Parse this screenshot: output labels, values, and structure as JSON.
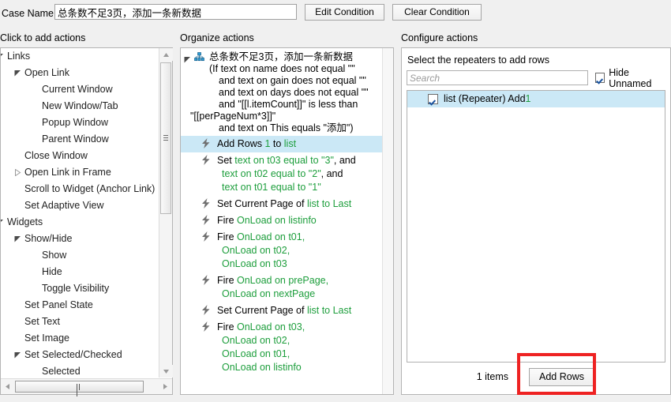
{
  "header": {
    "case_name_label": "Case Name",
    "case_name_value": "总条数不足3页，添加一条新数据",
    "edit_condition_label": "Edit Condition",
    "clear_condition_label": "Clear Condition"
  },
  "columns": {
    "left_caption": "Click to add actions",
    "mid_caption": "Organize actions",
    "right_caption": "Configure actions"
  },
  "action_tree": {
    "items": [
      {
        "label": "Links",
        "level": 0,
        "twisty": "expanded"
      },
      {
        "label": "Open Link",
        "level": 1,
        "twisty": "expanded"
      },
      {
        "label": "Current Window",
        "level": 2,
        "twisty": "none"
      },
      {
        "label": "New Window/Tab",
        "level": 2,
        "twisty": "none"
      },
      {
        "label": "Popup Window",
        "level": 2,
        "twisty": "none"
      },
      {
        "label": "Parent Window",
        "level": 2,
        "twisty": "none"
      },
      {
        "label": "Close Window",
        "level": 1,
        "twisty": "none"
      },
      {
        "label": "Open Link in Frame",
        "level": 1,
        "twisty": "collapsed"
      },
      {
        "label": "Scroll to Widget (Anchor Link)",
        "level": 1,
        "twisty": "none"
      },
      {
        "label": "Set Adaptive View",
        "level": 1,
        "twisty": "none"
      },
      {
        "label": "Widgets",
        "level": 0,
        "twisty": "expanded"
      },
      {
        "label": "Show/Hide",
        "level": 1,
        "twisty": "expanded"
      },
      {
        "label": "Show",
        "level": 2,
        "twisty": "none"
      },
      {
        "label": "Hide",
        "level": 2,
        "twisty": "none"
      },
      {
        "label": "Toggle Visibility",
        "level": 2,
        "twisty": "none"
      },
      {
        "label": "Set Panel State",
        "level": 1,
        "twisty": "none"
      },
      {
        "label": "Set Text",
        "level": 1,
        "twisty": "none"
      },
      {
        "label": "Set Image",
        "level": 1,
        "twisty": "none"
      },
      {
        "label": "Set Selected/Checked",
        "level": 1,
        "twisty": "expanded"
      },
      {
        "label": "Selected",
        "level": 2,
        "twisty": "none"
      }
    ]
  },
  "organize": {
    "case_title": "总条数不足3页，添加一条新数据",
    "condition_lines": [
      {
        "text": "(If text on name does not equal \"\"",
        "indent": 0
      },
      {
        "text": "and text on gain does not equal \"\"",
        "indent": 1
      },
      {
        "text": "and text on days does not equal \"\"",
        "indent": 1
      },
      {
        "text": "and \"[[l.itemCount]]\" is less than",
        "indent": 1
      },
      {
        "text": "\"[[perPageNum*3]]\"",
        "indent": 2
      },
      {
        "text": "and text on This equals \"添加\")",
        "indent": 1
      }
    ],
    "actions": [
      {
        "selected": true,
        "lines": [
          [
            {
              "t": "Add Rows ",
              "g": false
            },
            {
              "t": "1",
              "g": true
            },
            {
              "t": " to ",
              "g": false
            },
            {
              "t": "list",
              "g": true
            }
          ]
        ]
      },
      {
        "selected": false,
        "lines": [
          [
            {
              "t": "Set ",
              "g": false
            },
            {
              "t": "text on t03 equal to \"3\"",
              "g": true
            },
            {
              "t": ", and",
              "g": false
            }
          ],
          [
            {
              "t": "text on t02 equal to \"2\"",
              "g": true
            },
            {
              "t": ", and",
              "g": false
            }
          ],
          [
            {
              "t": "text on t01 equal to \"1\"",
              "g": true
            }
          ]
        ]
      },
      {
        "selected": false,
        "lines": [
          [
            {
              "t": "Set Current Page of ",
              "g": false
            },
            {
              "t": "list to Last",
              "g": true
            }
          ]
        ]
      },
      {
        "selected": false,
        "lines": [
          [
            {
              "t": "Fire ",
              "g": false
            },
            {
              "t": "OnLoad on listinfo",
              "g": true
            }
          ]
        ]
      },
      {
        "selected": false,
        "lines": [
          [
            {
              "t": "Fire ",
              "g": false
            },
            {
              "t": "OnLoad on t01,",
              "g": true
            }
          ],
          [
            {
              "t": "OnLoad on t02,",
              "g": true
            }
          ],
          [
            {
              "t": "OnLoad on t03",
              "g": true
            }
          ]
        ]
      },
      {
        "selected": false,
        "lines": [
          [
            {
              "t": "Fire ",
              "g": false
            },
            {
              "t": "OnLoad on prePage,",
              "g": true
            }
          ],
          [
            {
              "t": "OnLoad on nextPage",
              "g": true
            }
          ]
        ]
      },
      {
        "selected": false,
        "lines": [
          [
            {
              "t": "Set Current Page of ",
              "g": false
            },
            {
              "t": "list to Last",
              "g": true
            }
          ]
        ]
      },
      {
        "selected": false,
        "lines": [
          [
            {
              "t": "Fire ",
              "g": false
            },
            {
              "t": "OnLoad on t03,",
              "g": true
            }
          ],
          [
            {
              "t": "OnLoad on t02,",
              "g": true
            }
          ],
          [
            {
              "t": "OnLoad on t01,",
              "g": true
            }
          ],
          [
            {
              "t": "OnLoad on listinfo",
              "g": true
            }
          ]
        ]
      }
    ]
  },
  "configure": {
    "title": "Select the repeaters to add rows",
    "search_placeholder": "Search",
    "search_value": "",
    "hide_unnamed_label": "Hide Unnamed",
    "hide_unnamed_checked": true,
    "repeaters": [
      {
        "checked": true,
        "selected": true,
        "name": "list (Repeater) Add ",
        "count": "1"
      }
    ],
    "count_label": "1 items",
    "add_rows_label": "Add Rows"
  },
  "colors": {
    "selection": "#cbe8f6",
    "green_text": "#1d9e3c",
    "highlight_red": "#ee2222",
    "panel_border": "#b4b4b4"
  }
}
